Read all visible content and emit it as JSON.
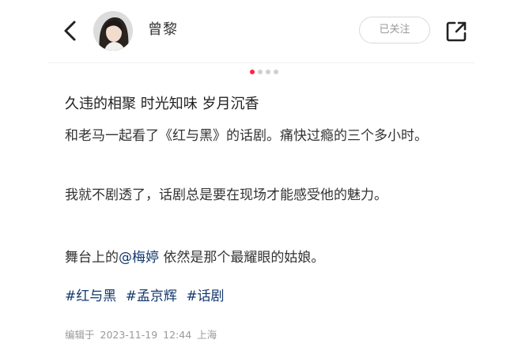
{
  "header": {
    "author_name": "曾黎",
    "follow_label": "已关注"
  },
  "pager": {
    "count": 4,
    "active_index": 0,
    "accent_color": "#ff2442"
  },
  "post": {
    "title": "久违的相聚 时光知味 岁月沉香",
    "paragraph1": "和老马一起看了《红与黑》的话剧。痛快过瘾的三个多小时。",
    "paragraph2": "我就不剧透了，话剧总是要在现场才能感受他的魅力。",
    "paragraph3_prefix": "舞台上的",
    "mention": "@梅婷",
    "paragraph3_suffix": " 依然是那个最耀眼的姑娘。",
    "tags": [
      "#红与黑",
      "#孟京辉",
      "#话剧"
    ],
    "meta": {
      "edited_label": "编辑于",
      "date": "2023-11-19",
      "time": "12:44",
      "location": "上海"
    }
  },
  "icons": {
    "back": "chevron-left-icon",
    "share": "share-icon"
  },
  "colors": {
    "link": "#13386c",
    "muted": "#999999"
  }
}
